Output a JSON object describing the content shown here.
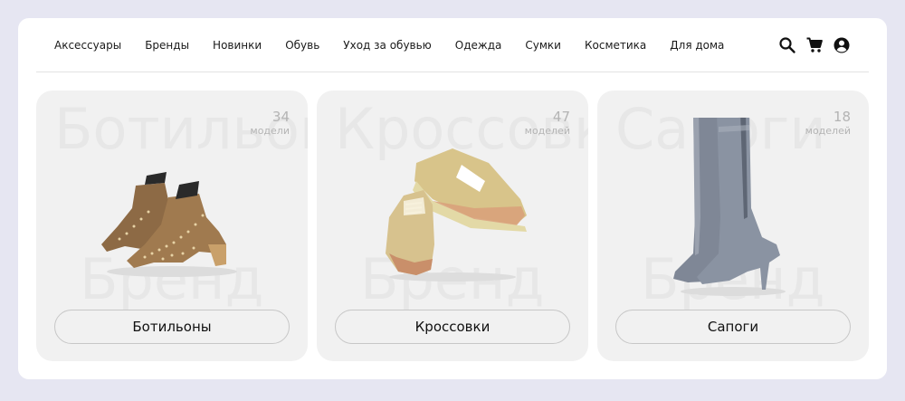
{
  "nav": {
    "items": [
      {
        "label": "Аксессуары"
      },
      {
        "label": "Бренды"
      },
      {
        "label": "Новинки"
      },
      {
        "label": "Обувь"
      },
      {
        "label": "Уход за обувью"
      },
      {
        "label": "Одежда"
      },
      {
        "label": "Сумки"
      },
      {
        "label": "Косметика"
      },
      {
        "label": "Для дома"
      }
    ],
    "icons": [
      "search-icon",
      "cart-icon",
      "account-icon"
    ]
  },
  "cards": [
    {
      "title": "Ботильоны",
      "watermark_top": "Ботильоны",
      "watermark_bottom": "Бренд",
      "count": "34",
      "count_unit": "модели",
      "image": "ankle-boots-image"
    },
    {
      "title": "Кроссовки",
      "watermark_top": "Кроссовки",
      "watermark_bottom": "Бренд",
      "count": "47",
      "count_unit": "моделей",
      "image": "sneakers-image"
    },
    {
      "title": "Сапоги",
      "watermark_top": "Сапоги",
      "watermark_bottom": "Бренд",
      "count": "18",
      "count_unit": "моделей",
      "image": "tall-boots-image"
    }
  ],
  "colors": {
    "page_background": "#e6e6f2",
    "frame_background": "#ffffff",
    "card_background": "#f1f1f1",
    "watermark": "#e7e7e7",
    "count_text": "#b4b4b4",
    "button_border": "#c7c7c7"
  }
}
